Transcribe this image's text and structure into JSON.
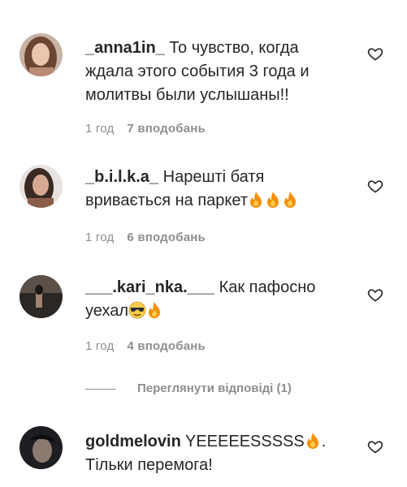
{
  "comments": [
    {
      "username": "_anna1in_",
      "text": "То чувство, когда ждала этого события 3 года и молитвы были услышаны!!",
      "time": "1 год",
      "likes": "7 вподобань",
      "emoji": []
    },
    {
      "username": "_b.i.l.k.a_",
      "text": "Нарешті батя вривається на паркет",
      "time": "1 год",
      "likes": "6 вподобань",
      "emoji": [
        "fire-icon",
        "fire-icon",
        "fire-icon"
      ]
    },
    {
      "username": "___.kari_nka.___",
      "text": "Как пафосно уехал",
      "time": "1 год",
      "likes": "4 вподобань",
      "emoji": [
        "sunglasses-smile-icon",
        "fire-icon"
      ]
    },
    {
      "username": "goldmelovin",
      "text_before": "YEEEEESSSSS",
      "text_after": ". Тільки перемога!",
      "emoji": [
        "fire-icon"
      ]
    }
  ],
  "view_replies": "Переглянути відповіді (1)",
  "colors": {
    "text": "#262626",
    "meta": "#8e8e8e",
    "fire": "#f4900c"
  }
}
